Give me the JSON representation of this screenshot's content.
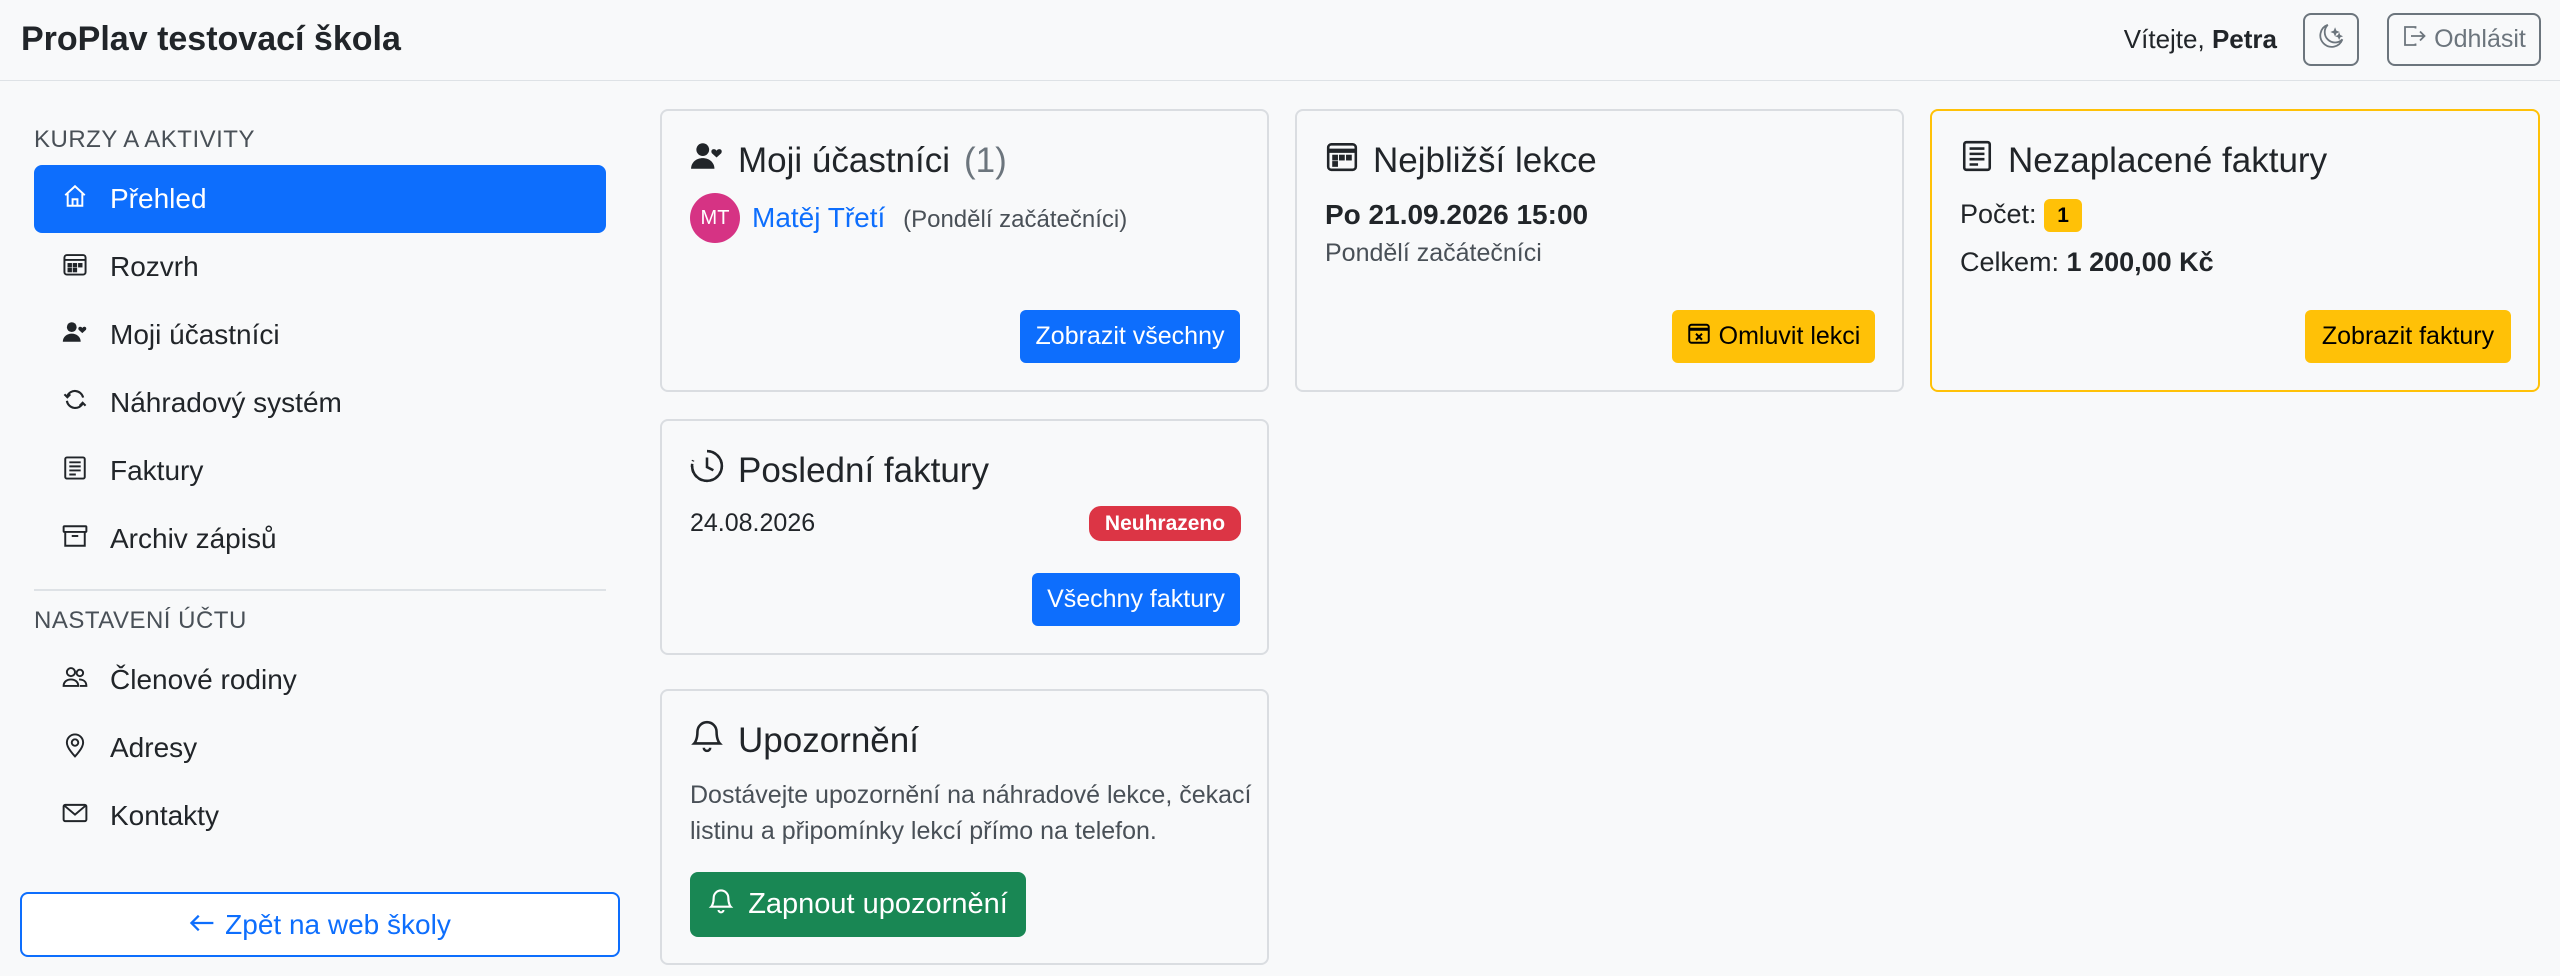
{
  "header": {
    "brand": "ProPlav testovací škola",
    "welcome_prefix": "Vítejte,",
    "user_name": "Petra",
    "theme_icon": "moon-stars-icon",
    "logout_label": "Odhlásit"
  },
  "sidebar": {
    "section1_title": "KURZY A AKTIVITY",
    "section1_items": [
      {
        "label": "Přehled",
        "icon": "house-icon",
        "active": true
      },
      {
        "label": "Rozvrh",
        "icon": "calendar-week-icon"
      },
      {
        "label": "Moji účastníci",
        "icon": "person-heart-icon"
      },
      {
        "label": "Náhradový systém",
        "icon": "arrow-repeat-icon"
      },
      {
        "label": "Faktury",
        "icon": "receipt-icon"
      },
      {
        "label": "Archiv zápisů",
        "icon": "archive-icon"
      }
    ],
    "section2_title": "NASTAVENÍ ÚČTU",
    "section2_items": [
      {
        "label": "Členové rodiny",
        "icon": "people-icon"
      },
      {
        "label": "Adresy",
        "icon": "geo-alt-icon"
      },
      {
        "label": "Kontakty",
        "icon": "envelope-icon"
      }
    ],
    "back_label": "Zpět na web školy"
  },
  "cards": {
    "participants": {
      "title": "Moji účastníci",
      "count": "(1)",
      "avatar_initials": "MT",
      "participant_name": "Matěj Třetí",
      "participant_course": "(Pondělí začátečníci)",
      "button": "Zobrazit všechny"
    },
    "next_lesson": {
      "title": "Nejbližší lekce",
      "datetime": "Po 21.09.2026 15:00",
      "course": "Pondělí začátečníci",
      "button": "Omluvit lekci"
    },
    "unpaid": {
      "title": "Nezaplacené faktury",
      "count_label": "Počet:",
      "count_value": "1",
      "total_label": "Celkem:",
      "total_value": "1 200,00 Kč",
      "button": "Zobrazit faktury"
    },
    "recent_invoices": {
      "title": "Poslední faktury",
      "date": "24.08.2026",
      "status": "Neuhrazeno",
      "button": "Všechny faktury"
    },
    "notifications": {
      "title": "Upozornění",
      "text_line1": "Dostávejte upozornění na náhradové lekce, čekací",
      "text_line2": "listinu a připomínky lekcí přímo na telefon.",
      "button": "Zapnout upozornění"
    }
  },
  "colors": {
    "primary": "#0d6efd",
    "warning": "#ffc107",
    "danger": "#dc3545",
    "success": "#198754",
    "avatar": "#d63384"
  }
}
